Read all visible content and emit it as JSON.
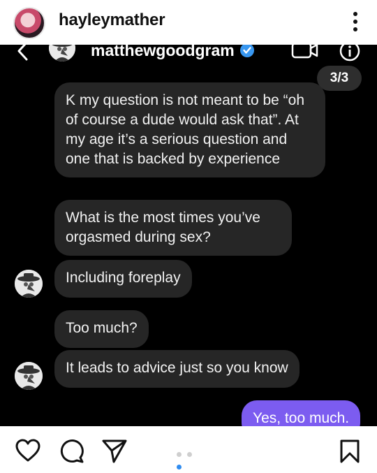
{
  "post": {
    "username": "hayleymather"
  },
  "dm": {
    "username": "matthewgoodgram",
    "page_indicator": "3/3",
    "messages": [
      {
        "sender": "them",
        "text": "K my question is not meant to be “oh of course a dude would ask that”. At my age it’s a serious question and one that is backed by experience"
      },
      {
        "sender": "them",
        "text": "What is the most times you’ve orgasmed during sex?"
      },
      {
        "sender": "them",
        "text": "Including foreplay"
      },
      {
        "sender": "them",
        "text": "Too much?"
      },
      {
        "sender": "them",
        "text": "It leads to advice just so you know"
      },
      {
        "sender": "me",
        "text": "Yes, too much."
      }
    ]
  },
  "carousel": {
    "count": 3,
    "active_index": 2
  },
  "icons": {
    "more": "more-vertical-icon",
    "back": "chevron-left-icon",
    "verified": "verified-badge-icon",
    "video": "video-call-icon",
    "info": "info-icon",
    "like": "heart-icon",
    "comment": "comment-icon",
    "share": "send-icon",
    "save": "bookmark-icon"
  },
  "colors": {
    "dm_background": "#000000",
    "their_bubble": "#262626",
    "my_bubble": "#7c5cf0",
    "verified": "#3897f0",
    "dot_active": "#2f8cf0"
  }
}
